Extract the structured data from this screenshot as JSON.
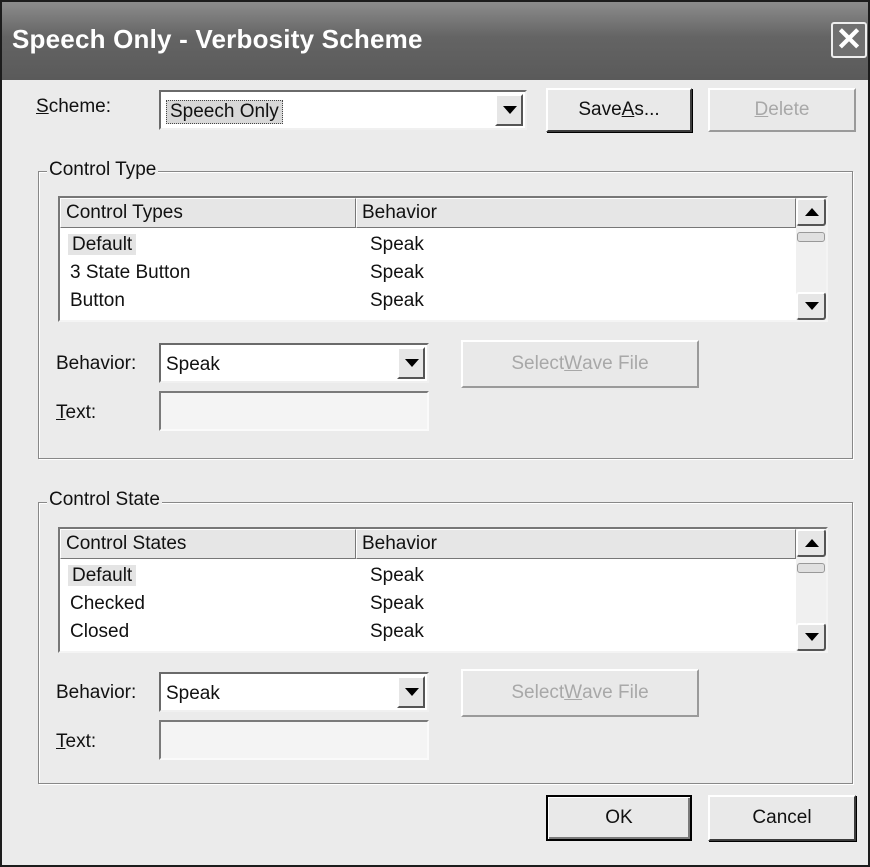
{
  "window": {
    "title": "Speech Only - Verbosity Scheme",
    "close_glyph": "✕"
  },
  "scheme": {
    "label_prefix": "",
    "label_mnemonic": "S",
    "label_rest": "cheme:",
    "value": "Speech Only",
    "save_as_label": "Save ",
    "save_as_mnemonic": "A",
    "save_as_rest": "s...",
    "delete_label": "",
    "delete_mnemonic": "D",
    "delete_rest": "elete"
  },
  "control_type": {
    "group_label": "Control Type",
    "columns": [
      "Control Types",
      "Behavior"
    ],
    "rows": [
      {
        "name": "Default",
        "behavior": "Speak"
      },
      {
        "name": "3 State Button",
        "behavior": "Speak"
      },
      {
        "name": "Button",
        "behavior": "Speak"
      }
    ],
    "behavior_label": "Behavior:",
    "behavior_value": "Speak",
    "wave_prefix": "Select ",
    "wave_mnemonic": "W",
    "wave_rest": "ave File",
    "text_mnemonic": "T",
    "text_rest": "ext:",
    "text_value": ""
  },
  "control_state": {
    "group_label": "Control State",
    "columns": [
      "Control States",
      "Behavior"
    ],
    "rows": [
      {
        "name": "Default",
        "behavior": "Speak"
      },
      {
        "name": "Checked",
        "behavior": "Speak"
      },
      {
        "name": "Closed",
        "behavior": "Speak"
      }
    ],
    "behavior_label": "Behavior:",
    "behavior_value": "Speak",
    "wave_prefix": "Select ",
    "wave_mnemonic": "W",
    "wave_rest": "ave File",
    "text_mnemonic": "T",
    "text_rest": "ext:",
    "text_value": ""
  },
  "footer": {
    "ok_label": "OK",
    "cancel_label": "Cancel"
  }
}
